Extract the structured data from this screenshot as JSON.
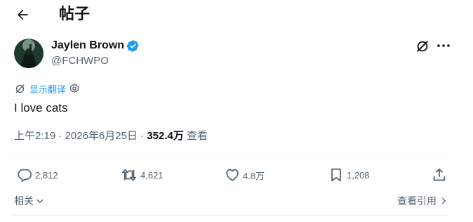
{
  "header": {
    "title": "帖子"
  },
  "post": {
    "author_name": "Jaylen Brown",
    "handle": "@FCHWPO",
    "translate_label": "显示翻译",
    "text": "I love cats",
    "time": "上午2:19",
    "sep1": "·",
    "date": "2026年6月25日",
    "sep2": "·",
    "views_count": "352.4万",
    "views_label": "查看"
  },
  "actions": {
    "replies": "2,812",
    "reposts": "4,621",
    "likes": "4.8万",
    "bookmarks": "1,208"
  },
  "footer": {
    "related_label": "相关",
    "quotes_label": "查看引用"
  },
  "colors": {
    "accent": "#1d9bf0",
    "secondary_text": "#536471",
    "primary_text": "#0f1419"
  },
  "icons": [
    "back-arrow-icon",
    "verified-badge-icon",
    "grok-icon",
    "more-icon",
    "translate-icon",
    "settings-icon",
    "reply-icon",
    "repost-icon",
    "like-icon",
    "bookmark-icon",
    "share-icon",
    "chevron-down-icon",
    "chevron-right-icon"
  ]
}
